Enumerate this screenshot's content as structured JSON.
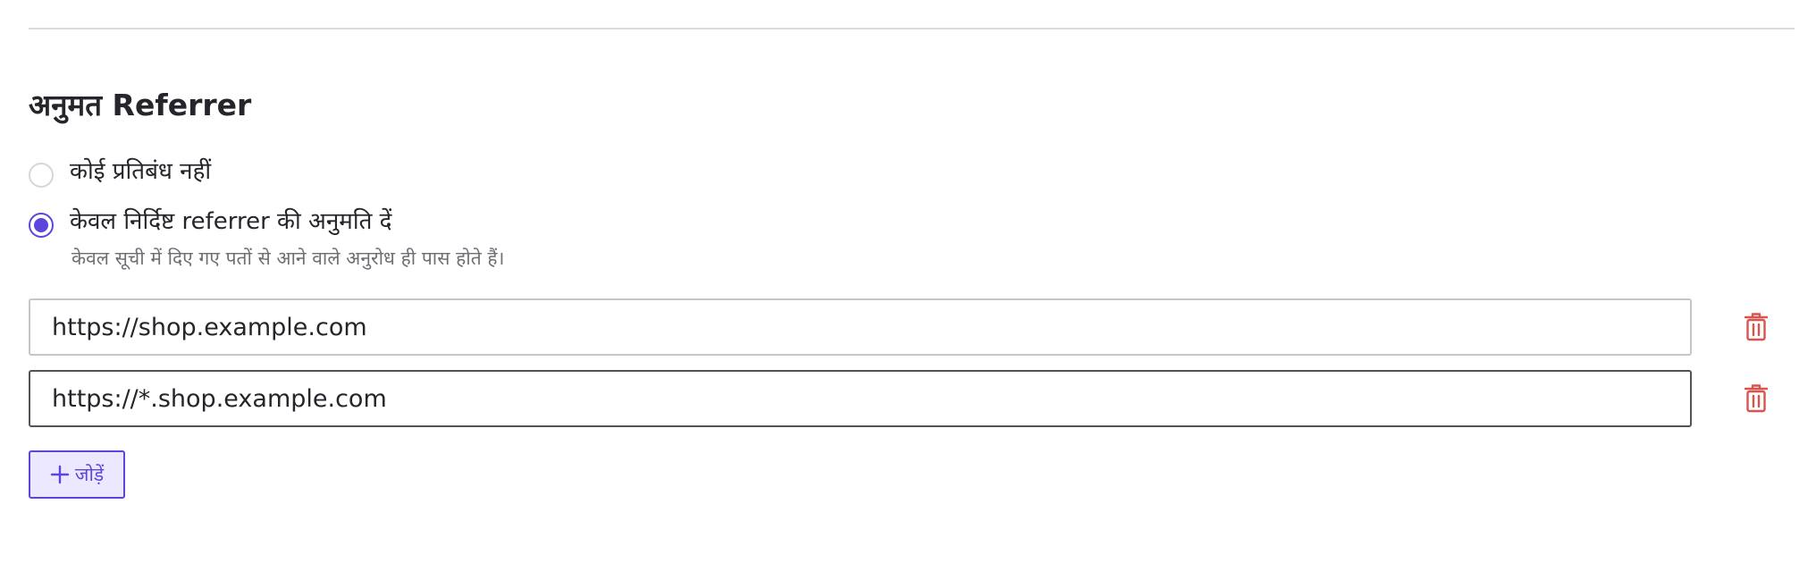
{
  "section": {
    "title": "अनुमत Referrer"
  },
  "restriction": {
    "options": [
      {
        "label": "कोई प्रतिबंध नहीं",
        "selected": false
      },
      {
        "label": "केवल निर्दिष्ट referrer की अनुमति दें",
        "selected": true,
        "description": "केवल सूची में दिए गए पतों से आने वाले अनुरोध ही पास होते हैं।"
      }
    ]
  },
  "referrers": [
    {
      "value": "https://shop.example.com",
      "focused": false
    },
    {
      "value": "https://*.shop.example.com",
      "focused": true
    }
  ],
  "add_button": {
    "label": "जोड़ें",
    "icon": "plus-icon"
  },
  "delete_icon": "trash-icon",
  "colors": {
    "accent": "#5b46dc",
    "accent_bg": "#ebe8ff",
    "danger": "#d9534f",
    "text": "#25252b",
    "muted_text": "#6e6e75",
    "border": "#c6c6ca",
    "border_focused": "#525258"
  }
}
